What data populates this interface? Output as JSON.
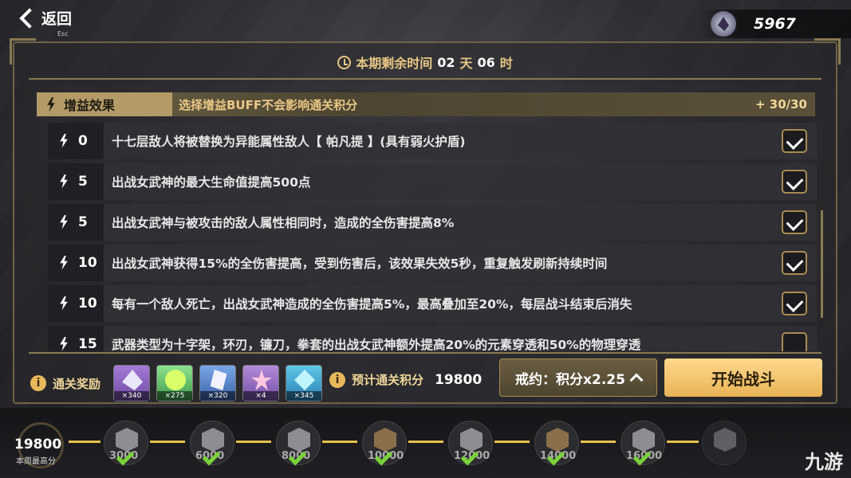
{
  "top": {
    "back_label": "返回",
    "back_hint": "Esc",
    "currency_icon": "crystal-icon",
    "currency_value": "5967"
  },
  "timer": {
    "label": "本期剩余时间",
    "days": "02",
    "day_unit": "天",
    "hours": "06",
    "hour_unit": "时"
  },
  "buff": {
    "title": "增益效果",
    "description": "选择增益BUFF不会影响通关积分",
    "count": "+ 30/30",
    "items": [
      {
        "cost": "0",
        "text": "十七层敌人将被替换为异能属性敌人【 帕凡提 】(具有弱火护盾)",
        "checked": true
      },
      {
        "cost": "5",
        "text": "出战女武神的最大生命值提高500点",
        "checked": true
      },
      {
        "cost": "5",
        "text": "出战女武神与被攻击的敌人属性相同时，造成的全伤害提高8%",
        "checked": true
      },
      {
        "cost": "10",
        "text": "出战女武神获得15%的全伤害提高，受到伤害后，该效果失效5秒，重复触发刷新持续时间",
        "checked": true
      },
      {
        "cost": "10",
        "text": "每有一个敌人死亡，出战女武神造成的全伤害提高5%，最高叠加至20%，每层战斗结束后消失",
        "checked": true
      },
      {
        "cost": "15",
        "text": "武器类型为十字架，环刃，镰刀，拳套的出战女武神额外提高20%的元素穿透和50%的物理穿透",
        "checked": false
      }
    ]
  },
  "rewards": {
    "label": "通关奖励",
    "items": [
      {
        "icon": "valkyrie-crystal-icon",
        "qty": "×340"
      },
      {
        "icon": "green-disc-icon",
        "qty": "×275"
      },
      {
        "icon": "feather-icon",
        "qty": "×320"
      },
      {
        "icon": "sakura-icon",
        "qty": "×4"
      },
      {
        "icon": "blue-crystal-icon",
        "qty": "×345"
      }
    ]
  },
  "score": {
    "label": "预计通关积分",
    "value": "19800"
  },
  "pact_button": {
    "label": "戒约：积分x2.25"
  },
  "start_button": {
    "label": "开始战斗"
  },
  "progress": {
    "best_value": "19800",
    "best_label": "本周最高分",
    "nodes": [
      {
        "value": "3000",
        "done": true
      },
      {
        "value": "6000",
        "done": true
      },
      {
        "value": "8000",
        "done": true
      },
      {
        "value": "10000",
        "done": true
      },
      {
        "value": "12000",
        "done": true
      },
      {
        "value": "14000",
        "done": true
      },
      {
        "value": "16000",
        "done": true
      }
    ]
  },
  "watermark": "九游"
}
